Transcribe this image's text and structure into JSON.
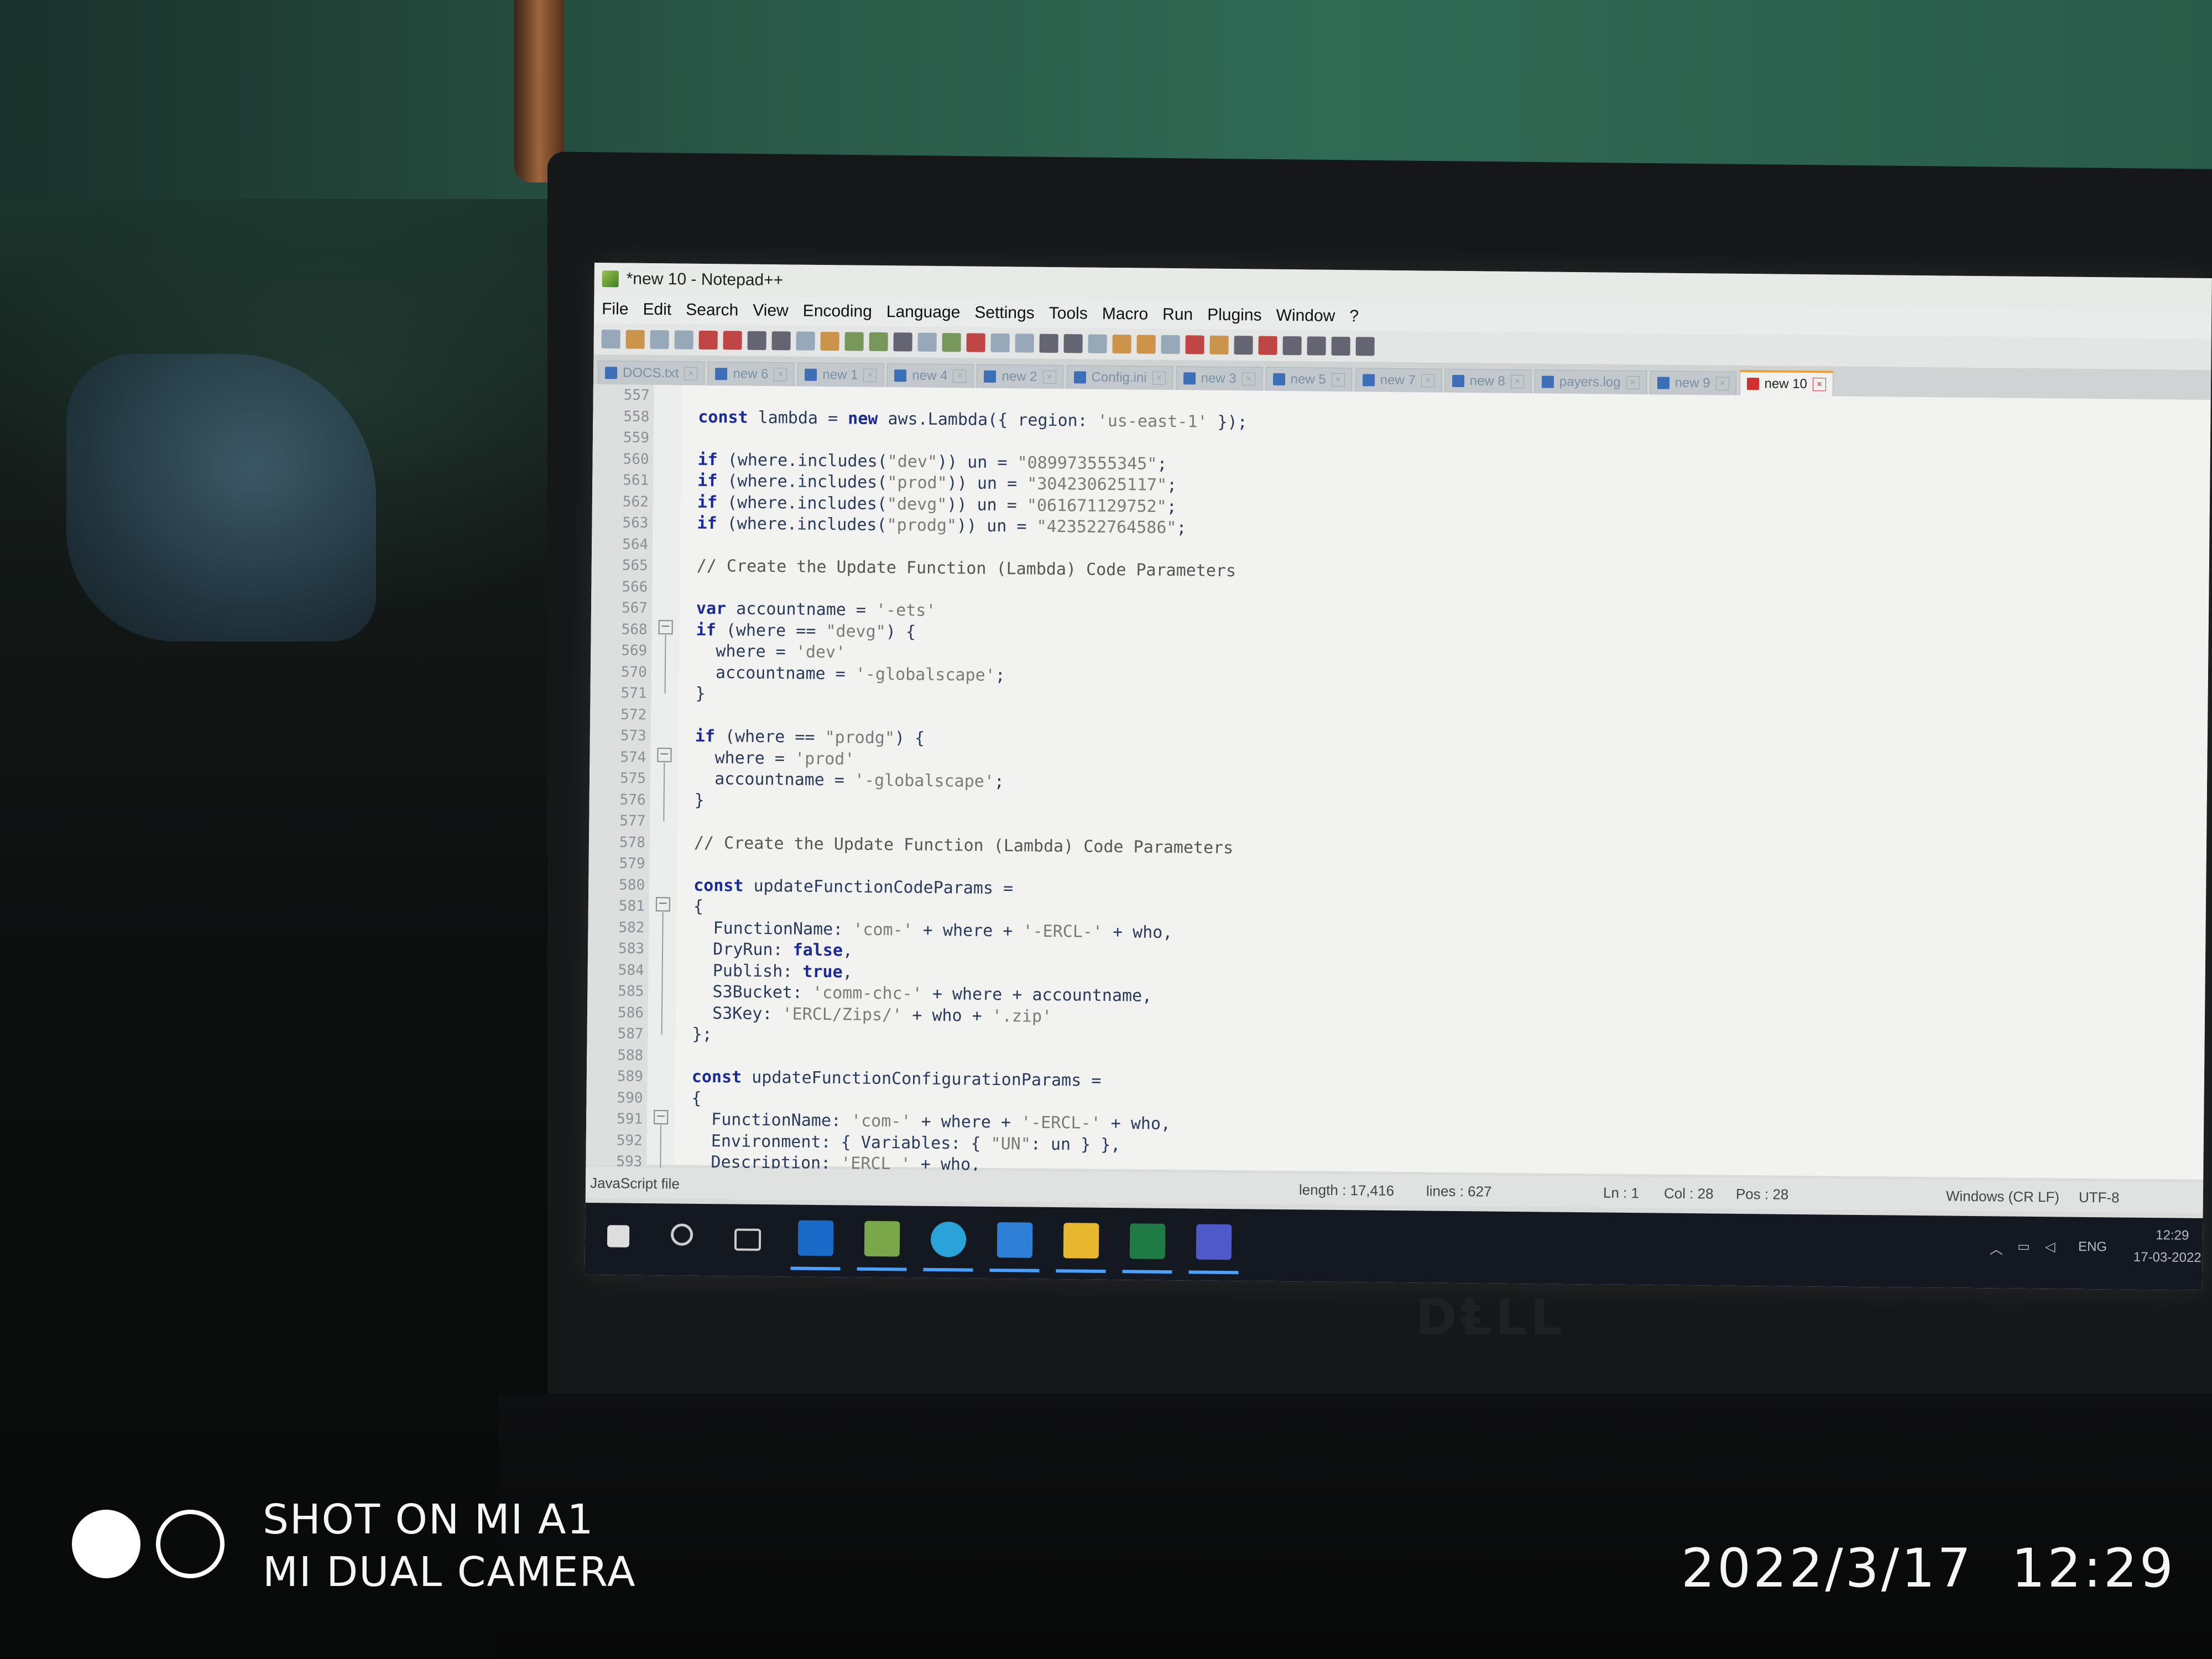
{
  "window": {
    "title": "*new 10 - Notepad++"
  },
  "menu": [
    "File",
    "Edit",
    "Search",
    "View",
    "Encoding",
    "Language",
    "Settings",
    "Tools",
    "Macro",
    "Run",
    "Plugins",
    "Window",
    "?"
  ],
  "tabs": [
    {
      "label": "DOCS.txt"
    },
    {
      "label": "new 6"
    },
    {
      "label": "new 1"
    },
    {
      "label": "new 4"
    },
    {
      "label": "new 2"
    },
    {
      "label": "Config.ini"
    },
    {
      "label": "new 3"
    },
    {
      "label": "new 5"
    },
    {
      "label": "new 7"
    },
    {
      "label": "new 8"
    },
    {
      "label": "payers.log"
    },
    {
      "label": "new 9"
    },
    {
      "label": "new 10",
      "active": true
    }
  ],
  "editor": {
    "line_numbers": [
      "557",
      "558",
      "559",
      "560",
      "561",
      "562",
      "563",
      "564",
      "565",
      "566",
      "567",
      "568",
      "569",
      "570",
      "571",
      "572",
      "573",
      "574",
      "575",
      "576",
      "577",
      "578",
      "579",
      "580",
      "581",
      "582",
      "583",
      "584",
      "585",
      "586",
      "587",
      "588",
      "589",
      "590",
      "591",
      "592",
      "593"
    ],
    "lines": [
      "",
      "const lambda = new aws.Lambda({ region: 'us-east-1' });",
      "",
      "if (where.includes(\"dev\")) un = \"089973555345\";",
      "if (where.includes(\"prod\")) un = \"304230625117\";",
      "if (where.includes(\"devg\")) un = \"061671129752\";",
      "if (where.includes(\"prodg\")) un = \"423522764586\";",
      "",
      "// Create the Update Function (Lambda) Code Parameters",
      "",
      "var accountname = '-ets'",
      "if (where == \"devg\") {",
      "  where = 'dev'",
      "  accountname = '-globalscape';",
      "}",
      "",
      "if (where == \"prodg\") {",
      "  where = 'prod'",
      "  accountname = '-globalscape';",
      "}",
      "",
      "// Create the Update Function (Lambda) Code Parameters",
      "",
      "const updateFunctionCodeParams =",
      "{",
      "  FunctionName: 'com-' + where + '-ERCL-' + who,",
      "  DryRun: false,",
      "  Publish: true,",
      "  S3Bucket: 'comm-chc-' + where + accountname,",
      "  S3Key: 'ERCL/Zips/' + who + '.zip'",
      "};",
      "",
      "const updateFunctionConfigurationParams =",
      "{",
      "  FunctionName: 'com-' + where + '-ERCL-' + who,",
      "  Environment: { Variables: { \"UN\": un } },",
      "  Description: 'ERCL ' + who,"
    ]
  },
  "status": {
    "filetype": "JavaScript file",
    "length": "length : 17,416",
    "lines": "lines : 627",
    "ln": "Ln : 1",
    "col": "Col : 28",
    "pos": "Pos : 28",
    "eol": "Windows (CR LF)",
    "encoding": "UTF-8"
  },
  "tray": {
    "lang": "ENG",
    "time": "12:29",
    "date": "17-03-2022"
  },
  "taskbar_icons": [
    "start-icon",
    "search-icon",
    "task-view-icon",
    "outlook-icon",
    "notepadpp-icon",
    "edge-icon",
    "vscode-icon",
    "file-explorer-icon",
    "excel-icon",
    "teams-icon"
  ],
  "watermark": {
    "line1": "SHOT ON MI A1",
    "line2": "MI DUAL CAMERA",
    "datetime": "2022/3/17  12:29"
  },
  "colors": {
    "keyword": "#1a2a9a",
    "string": "#7a7a7a",
    "active_tab_accent": "#f0a030",
    "taskbar": "#141820"
  }
}
